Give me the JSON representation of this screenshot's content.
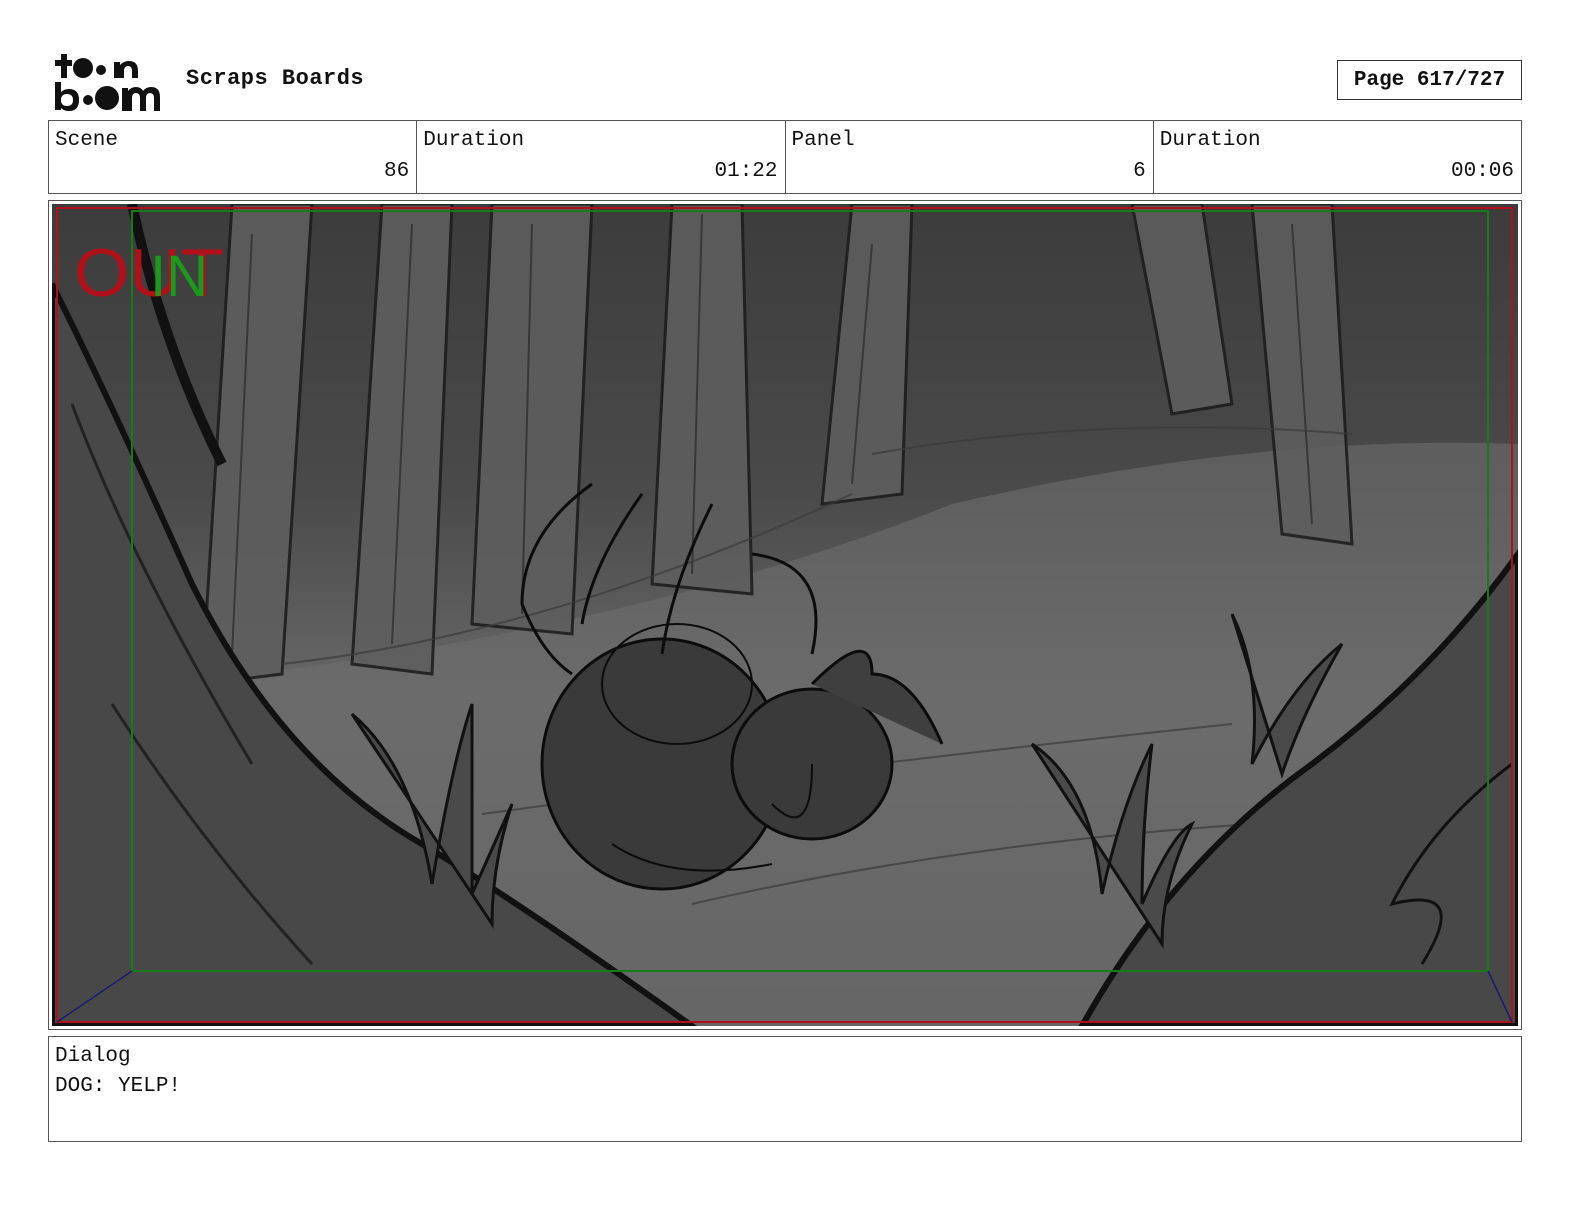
{
  "header": {
    "logo_text": "toonboom",
    "title": "Scraps Boards",
    "page": "Page 617/727"
  },
  "info": {
    "scene_label": "Scene",
    "scene_value": "86",
    "scene_duration_label": "Duration",
    "scene_duration_value": "01:22",
    "panel_label": "Panel",
    "panel_value": "6",
    "panel_duration_label": "Duration",
    "panel_duration_value": "00:06"
  },
  "panel": {
    "out_text": "OUT",
    "in_text": "IN"
  },
  "dialog": {
    "label": "Dialog",
    "text": "DOG: YELP!"
  },
  "colors": {
    "out_frame": "#b0101a",
    "in_frame": "#1a7a1a"
  }
}
